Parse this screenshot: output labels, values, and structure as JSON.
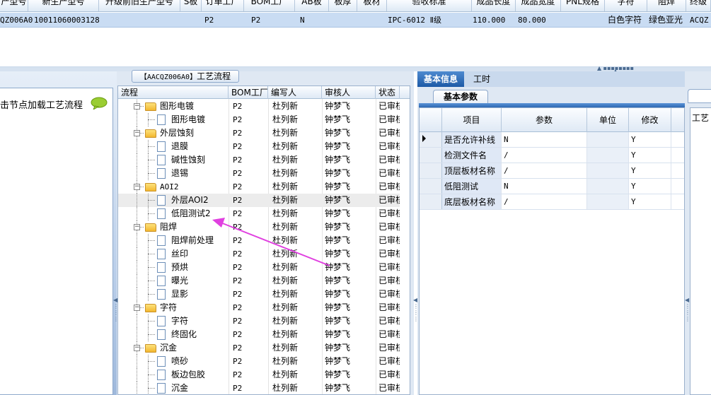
{
  "top_grid": {
    "headers": [
      "产型号",
      "新生产型号",
      "升级前旧生产型号",
      "S板",
      "订单工厂",
      "BOM工厂",
      "AB板",
      "板厚",
      "板材",
      "验收标准",
      "成品长度",
      "成品宽度",
      "PNL规格",
      "字符",
      "阻焊",
      "终级"
    ],
    "row": {
      "old_code": "QZ006A0",
      "new_code": "10011060003128",
      "order_factory": "P2",
      "bom_factory": "P2",
      "ab": "N",
      "standard": "IPC-6012 Ⅱ级",
      "length": "110.000",
      "width": "80.000",
      "char": "白色字符",
      "mask": "绿色亚光",
      "final": "ACQZ"
    }
  },
  "left_panel": {
    "hint": "击节点加载工艺流程"
  },
  "flow": {
    "tab_code": "【AACQZ006A0】",
    "tab_label": "工艺流程",
    "headers": [
      "流程",
      "BOM工厂",
      "编写人",
      "审核人",
      "状态"
    ],
    "rows": [
      {
        "level": 0,
        "name": "图形电镀",
        "bom": "P2",
        "author": "杜列新",
        "reviewer": "钟梦飞",
        "status": "已审核"
      },
      {
        "level": 1,
        "name": "图形电镀",
        "bom": "P2",
        "author": "杜列新",
        "reviewer": "钟梦飞",
        "status": "已审核"
      },
      {
        "level": 0,
        "name": "外层蚀刻",
        "bom": "P2",
        "author": "杜列新",
        "reviewer": "钟梦飞",
        "status": "已审核"
      },
      {
        "level": 1,
        "name": "退膜",
        "bom": "P2",
        "author": "杜列新",
        "reviewer": "钟梦飞",
        "status": "已审核"
      },
      {
        "level": 1,
        "name": "碱性蚀刻",
        "bom": "P2",
        "author": "杜列新",
        "reviewer": "钟梦飞",
        "status": "已审核"
      },
      {
        "level": 1,
        "name": "退锡",
        "bom": "P2",
        "author": "杜列新",
        "reviewer": "钟梦飞",
        "status": "已审核"
      },
      {
        "level": 0,
        "name": "AOI2",
        "bom": "P2",
        "author": "杜列新",
        "reviewer": "钟梦飞",
        "status": "已审核"
      },
      {
        "level": 1,
        "name": "外层AOI2",
        "bom": "P2",
        "author": "杜列新",
        "reviewer": "钟梦飞",
        "status": "已审核"
      },
      {
        "level": 1,
        "name": "低阻测试2",
        "bom": "P2",
        "author": "杜列新",
        "reviewer": "钟梦飞",
        "status": "已审核"
      },
      {
        "level": 0,
        "name": "阻焊",
        "bom": "P2",
        "author": "杜列新",
        "reviewer": "钟梦飞",
        "status": "已审核"
      },
      {
        "level": 1,
        "name": "阻焊前处理",
        "bom": "P2",
        "author": "杜列新",
        "reviewer": "钟梦飞",
        "status": "已审核"
      },
      {
        "level": 1,
        "name": "丝印",
        "bom": "P2",
        "author": "杜列新",
        "reviewer": "钟梦飞",
        "status": "已审核"
      },
      {
        "level": 1,
        "name": "预烘",
        "bom": "P2",
        "author": "杜列新",
        "reviewer": "钟梦飞",
        "status": "已审核"
      },
      {
        "level": 1,
        "name": "曝光",
        "bom": "P2",
        "author": "杜列新",
        "reviewer": "钟梦飞",
        "status": "已审核"
      },
      {
        "level": 1,
        "name": "显影",
        "bom": "P2",
        "author": "杜列新",
        "reviewer": "钟梦飞",
        "status": "已审核"
      },
      {
        "level": 0,
        "name": "字符",
        "bom": "P2",
        "author": "杜列新",
        "reviewer": "钟梦飞",
        "status": "已审核"
      },
      {
        "level": 1,
        "name": "字符",
        "bom": "P2",
        "author": "杜列新",
        "reviewer": "钟梦飞",
        "status": "已审核"
      },
      {
        "level": 1,
        "name": "终固化",
        "bom": "P2",
        "author": "杜列新",
        "reviewer": "钟梦飞",
        "status": "已审核"
      },
      {
        "level": 0,
        "name": "沉金",
        "bom": "P2",
        "author": "杜列新",
        "reviewer": "钟梦飞",
        "status": "已审核"
      },
      {
        "level": 1,
        "name": "喷砂",
        "bom": "P2",
        "author": "杜列新",
        "reviewer": "钟梦飞",
        "status": "已审核"
      },
      {
        "level": 1,
        "name": "板边包胶",
        "bom": "P2",
        "author": "杜列新",
        "reviewer": "钟梦飞",
        "status": "已审核"
      },
      {
        "level": 1,
        "name": "沉金",
        "bom": "P2",
        "author": "杜列新",
        "reviewer": "钟梦飞",
        "status": "已审核"
      }
    ]
  },
  "right": {
    "tabs": [
      "基本信息",
      "工时"
    ],
    "subtab": "基本参数",
    "headers": [
      "项目",
      "参数",
      "单位",
      "修改"
    ],
    "rows": [
      {
        "item": "是否允许补线",
        "param": "N",
        "unit": "",
        "edit": "Y"
      },
      {
        "item": "检测文件名",
        "param": "/",
        "unit": "",
        "edit": "Y"
      },
      {
        "item": "顶层板材名称",
        "param": "/",
        "unit": "",
        "edit": "Y"
      },
      {
        "item": "低阻测试",
        "param": "N",
        "unit": "",
        "edit": "Y"
      },
      {
        "item": "底层板材名称",
        "param": "/",
        "unit": "",
        "edit": "Y"
      }
    ],
    "far_label": "工艺"
  },
  "colors": {
    "selected_row": "#c9dcf3",
    "tab_active": "#2d68b3",
    "arrow": "#e040e0",
    "folder": "#f2b72f"
  }
}
